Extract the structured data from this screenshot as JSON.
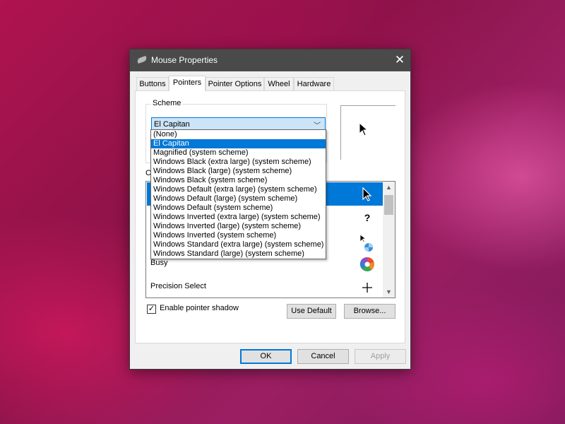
{
  "window": {
    "title": "Mouse Properties",
    "close_glyph": "✕"
  },
  "tabs": [
    {
      "label": "Buttons"
    },
    {
      "label": "Pointers",
      "active": true
    },
    {
      "label": "Pointer Options"
    },
    {
      "label": "Wheel"
    },
    {
      "label": "Hardware"
    }
  ],
  "scheme": {
    "group_label": "Scheme",
    "selected": "El Capitan",
    "arrow_glyph": "﹀",
    "options": [
      "(None)",
      "El Capitan",
      "Magnified (system scheme)",
      "Windows Black (extra large) (system scheme)",
      "Windows Black (large) (system scheme)",
      "Windows Black (system scheme)",
      "Windows Default (extra large) (system scheme)",
      "Windows Default (large) (system scheme)",
      "Windows Default (system scheme)",
      "Windows Inverted (extra large) (system scheme)",
      "Windows Inverted (large) (system scheme)",
      "Windows Inverted (system scheme)",
      "Windows Standard (extra large) (system scheme)",
      "Windows Standard (large) (system scheme)"
    ],
    "selected_index": 1
  },
  "customize": {
    "label": "Cu",
    "rows": [
      {
        "label": "",
        "icon": "arrow-cursor-icon",
        "selected": true
      },
      {
        "label": "",
        "icon": "help-cursor-icon"
      },
      {
        "label": "",
        "icon": "working-in-background-cursor-icon"
      },
      {
        "label": "Busy",
        "icon": "busy-cursor-icon"
      },
      {
        "label": "Precision Select",
        "icon": "crosshair-cursor-icon"
      }
    ],
    "help_glyph": "?",
    "up_glyph": "▲",
    "down_glyph": "▼"
  },
  "pointer_shadow": {
    "label": "Enable pointer shadow",
    "checked": true,
    "check_glyph": "✓"
  },
  "buttons": {
    "use_default": "Use Default",
    "browse": "Browse...",
    "ok": "OK",
    "cancel": "Cancel",
    "apply": "Apply"
  },
  "colors": {
    "accent": "#0078d7",
    "titlebar": "#4a4a4a",
    "dialog_bg": "#f0f0f0"
  }
}
